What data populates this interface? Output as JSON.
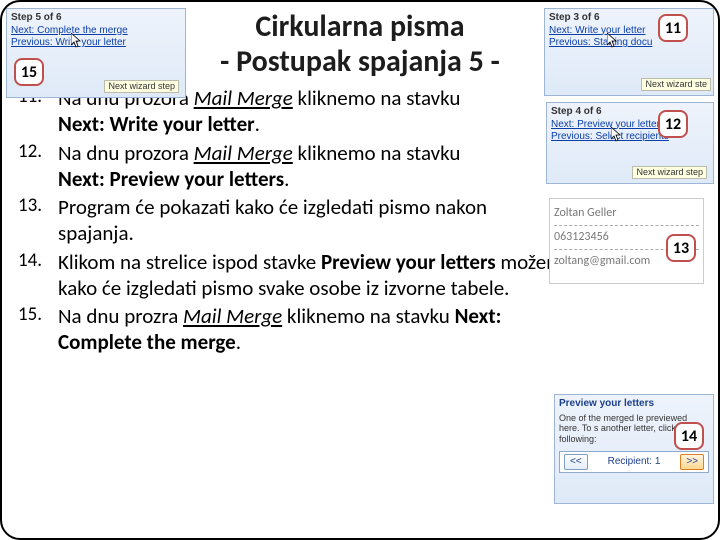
{
  "title_line1": "Cirkularna pisma",
  "title_line2": "- Postupak spajanja 5 -",
  "badges": {
    "n11": "11",
    "n12": "12",
    "n13": "13",
    "n14": "14",
    "n15": "15"
  },
  "steps": {
    "s11_a": "Na dnu prozora ",
    "s11_mm": "Mail Merge",
    "s11_b": " kliknemo na stavku ",
    "s11_bold": "Next: Write your letter",
    "s11_c": ".",
    "s12_a": "Na dnu prozora ",
    "s12_mm": "Mail Merge",
    "s12_b": " kliknemo na stavku ",
    "s12_bold": "Next: Preview your letters",
    "s12_c": ".",
    "s13": "Program će pokazati kako će izgledati pismo nakon spajanja.",
    "s14_a": "Klikom na strelice ispod stavke ",
    "s14_bold": "Preview your letters",
    "s14_b": " možemo pregledati kako će izgledati pismo svake osobe iz izvorne tabele.",
    "s15_a": "Na dnu prozra ",
    "s15_mm": "Mail Merge",
    "s15_b": " kliknemo na stavku ",
    "s15_bold": "Next: Complete the merge",
    "s15_c": "."
  },
  "panel11": {
    "hdr": "Step 3 of 6",
    "next": "Next: Write your letter",
    "prev": "Previous: Starting docu",
    "tip": "Next wizard ste"
  },
  "panel15": {
    "hdr": "Step 5 of 6",
    "next": "Next: Complete the merge",
    "prev": "Previous: Write your letter",
    "tip": "Next wizard step"
  },
  "panel12": {
    "hdr": "Step 4 of 6",
    "next": "Next: Preview your letters",
    "prev": "Previous: Select recipients",
    "tip": "Next wizard step"
  },
  "panel13": {
    "name": "Zoltan Geller",
    "phone": "063123456",
    "email": "zoltang@gmail.com"
  },
  "panel14": {
    "hdr": "Preview your letters",
    "body": "One of the merged le previewed here. To s another letter, click o following:",
    "prev": "<<",
    "label": "Recipient: 1",
    "next": ">>"
  }
}
